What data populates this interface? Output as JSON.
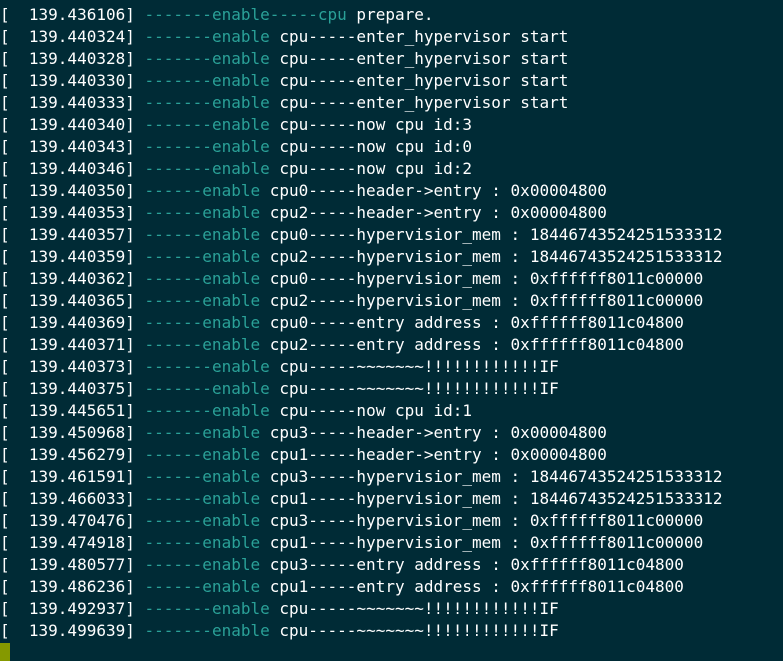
{
  "terminal": {
    "lines": [
      {
        "ts": "[  139.436106] ",
        "dash": "-------",
        "en": "enable",
        "rest_teal": "-----cpu",
        "rest_white": " prepare."
      },
      {
        "ts": "[  139.440324] ",
        "dash": "-------",
        "en": "enable",
        "rest_teal": "",
        "rest_white": " cpu-----enter_hypervisor start"
      },
      {
        "ts": "[  139.440328] ",
        "dash": "-------",
        "en": "enable",
        "rest_teal": "",
        "rest_white": " cpu-----enter_hypervisor start"
      },
      {
        "ts": "[  139.440330] ",
        "dash": "-------",
        "en": "enable",
        "rest_teal": "",
        "rest_white": " cpu-----enter_hypervisor start"
      },
      {
        "ts": "[  139.440333] ",
        "dash": "-------",
        "en": "enable",
        "rest_teal": "",
        "rest_white": " cpu-----enter_hypervisor start"
      },
      {
        "ts": "[  139.440340] ",
        "dash": "-------",
        "en": "enable",
        "rest_teal": "",
        "rest_white": " cpu-----now cpu id:3"
      },
      {
        "ts": "[  139.440343] ",
        "dash": "-------",
        "en": "enable",
        "rest_teal": "",
        "rest_white": " cpu-----now cpu id:0"
      },
      {
        "ts": "[  139.440346] ",
        "dash": "-------",
        "en": "enable",
        "rest_teal": "",
        "rest_white": " cpu-----now cpu id:2"
      },
      {
        "ts": "[  139.440350] ",
        "dash": "------",
        "en": "enable",
        "rest_teal": "",
        "rest_white": " cpu0-----header->entry : 0x00004800"
      },
      {
        "ts": "[  139.440353] ",
        "dash": "------",
        "en": "enable",
        "rest_teal": "",
        "rest_white": " cpu2-----header->entry : 0x00004800"
      },
      {
        "ts": "[  139.440357] ",
        "dash": "------",
        "en": "enable",
        "rest_teal": "",
        "rest_white": " cpu0-----hypervisior_mem : 18446743524251533312"
      },
      {
        "ts": "[  139.440359] ",
        "dash": "------",
        "en": "enable",
        "rest_teal": "",
        "rest_white": " cpu2-----hypervisior_mem : 18446743524251533312"
      },
      {
        "ts": "[  139.440362] ",
        "dash": "------",
        "en": "enable",
        "rest_teal": "",
        "rest_white": " cpu0-----hypervisior_mem : 0xffffff8011c00000"
      },
      {
        "ts": "[  139.440365] ",
        "dash": "------",
        "en": "enable",
        "rest_teal": "",
        "rest_white": " cpu2-----hypervisior_mem : 0xffffff8011c00000"
      },
      {
        "ts": "[  139.440369] ",
        "dash": "------",
        "en": "enable",
        "rest_teal": "",
        "rest_white": " cpu0-----entry address : 0xffffff8011c04800"
      },
      {
        "ts": "[  139.440371] ",
        "dash": "------",
        "en": "enable",
        "rest_teal": "",
        "rest_white": " cpu2-----entry address : 0xffffff8011c04800"
      },
      {
        "ts": "[  139.440373] ",
        "dash": "-------",
        "en": "enable",
        "rest_teal": "",
        "rest_white": " cpu-----~~~~~~~!!!!!!!!!!!!IF"
      },
      {
        "ts": "[  139.440375] ",
        "dash": "-------",
        "en": "enable",
        "rest_teal": "",
        "rest_white": " cpu-----~~~~~~~!!!!!!!!!!!!IF"
      },
      {
        "ts": "[  139.445651] ",
        "dash": "-------",
        "en": "enable",
        "rest_teal": "",
        "rest_white": " cpu-----now cpu id:1"
      },
      {
        "ts": "[  139.450968] ",
        "dash": "------",
        "en": "enable",
        "rest_teal": "",
        "rest_white": " cpu3-----header->entry : 0x00004800"
      },
      {
        "ts": "[  139.456279] ",
        "dash": "------",
        "en": "enable",
        "rest_teal": "",
        "rest_white": " cpu1-----header->entry : 0x00004800"
      },
      {
        "ts": "[  139.461591] ",
        "dash": "------",
        "en": "enable",
        "rest_teal": "",
        "rest_white": " cpu3-----hypervisior_mem : 18446743524251533312"
      },
      {
        "ts": "[  139.466033] ",
        "dash": "------",
        "en": "enable",
        "rest_teal": "",
        "rest_white": " cpu1-----hypervisior_mem : 18446743524251533312"
      },
      {
        "ts": "[  139.470476] ",
        "dash": "------",
        "en": "enable",
        "rest_teal": "",
        "rest_white": " cpu3-----hypervisior_mem : 0xffffff8011c00000"
      },
      {
        "ts": "[  139.474918] ",
        "dash": "------",
        "en": "enable",
        "rest_teal": "",
        "rest_white": " cpu1-----hypervisior_mem : 0xffffff8011c00000"
      },
      {
        "ts": "[  139.480577] ",
        "dash": "------",
        "en": "enable",
        "rest_teal": "",
        "rest_white": " cpu3-----entry address : 0xffffff8011c04800"
      },
      {
        "ts": "[  139.486236] ",
        "dash": "------",
        "en": "enable",
        "rest_teal": "",
        "rest_white": " cpu1-----entry address : 0xffffff8011c04800"
      },
      {
        "ts": "[  139.492937] ",
        "dash": "-------",
        "en": "enable",
        "rest_teal": "",
        "rest_white": " cpu-----~~~~~~~!!!!!!!!!!!!IF"
      },
      {
        "ts": "[  139.499639] ",
        "dash": "-------",
        "en": "enable",
        "rest_teal": "",
        "rest_white": " cpu-----~~~~~~~!!!!!!!!!!!!IF"
      }
    ]
  },
  "colors": {
    "background": "#002b36",
    "text": "#ffffff",
    "accent": "#2aa198",
    "cursor": "#859900"
  }
}
